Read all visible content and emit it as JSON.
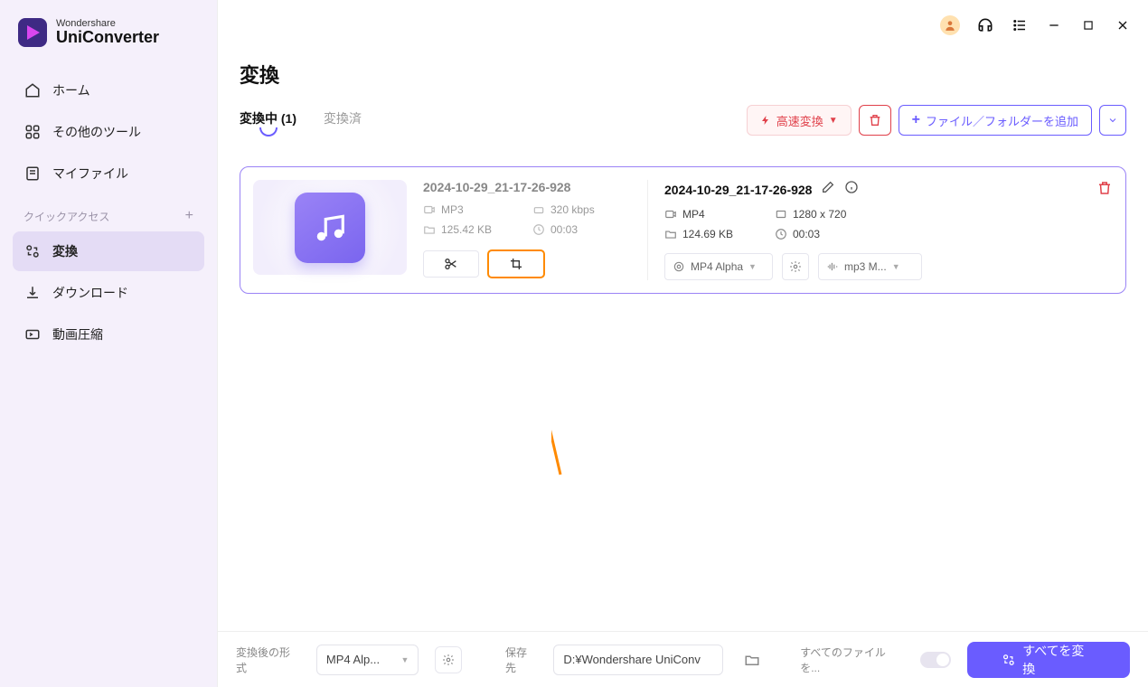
{
  "brand": {
    "sub": "Wondershare",
    "main": "UniConverter"
  },
  "sidebar": {
    "items": [
      {
        "label": "ホーム"
      },
      {
        "label": "その他のツール"
      },
      {
        "label": "マイファイル"
      }
    ],
    "quick_label": "クイックアクセス",
    "quick": [
      {
        "label": "変換"
      },
      {
        "label": "ダウンロード"
      },
      {
        "label": "動画圧縮"
      }
    ]
  },
  "page": {
    "title": "変換"
  },
  "tabs": {
    "active": {
      "label": "変換中",
      "count": "(1)"
    },
    "done": {
      "label": "変換済"
    }
  },
  "actions": {
    "fast": "高速変換",
    "add": "ファイル／フォルダーを追加"
  },
  "file": {
    "src": {
      "name": "2024-10-29_21-17-26-928",
      "format": "MP3",
      "bitrate": "320 kbps",
      "size": "125.42 KB",
      "duration": "00:03"
    },
    "dst": {
      "name": "2024-10-29_21-17-26-928",
      "format": "MP4",
      "resolution": "1280 x 720",
      "size": "124.69 KB",
      "duration": "00:03",
      "preset": "MP4 Alpha",
      "audio": "mp3 M..."
    }
  },
  "footer": {
    "format_label": "変換後の形式",
    "format_value": "MP4 Alp...",
    "dest_label": "保存先",
    "dest_value": "D:¥Wondershare UniConv",
    "all_files_label": "すべてのファイルを...",
    "convert_btn": "すべてを変換"
  }
}
